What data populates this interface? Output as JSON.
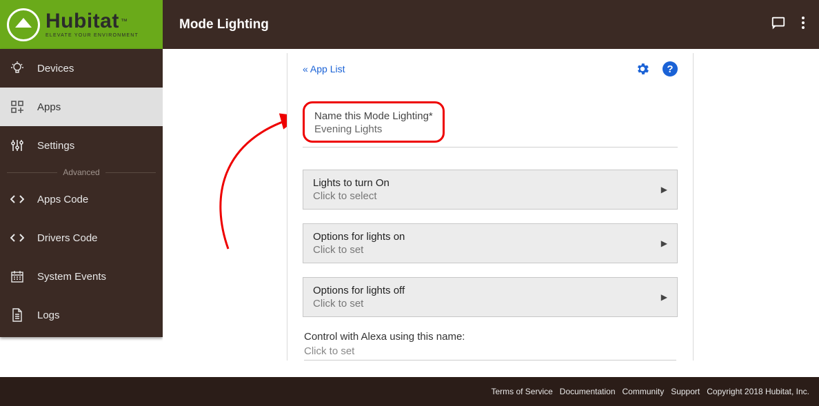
{
  "brand": {
    "name": "Hubitat",
    "tagline": "ELEVATE YOUR ENVIRONMENT",
    "tm": "™"
  },
  "header": {
    "title": "Mode Lighting"
  },
  "sidebar": {
    "items": [
      {
        "label": "Devices"
      },
      {
        "label": "Apps"
      },
      {
        "label": "Settings"
      }
    ],
    "advanced_label": "Advanced",
    "advanced_items": [
      {
        "label": "Apps Code"
      },
      {
        "label": "Drivers Code"
      },
      {
        "label": "System Events"
      },
      {
        "label": "Logs"
      }
    ]
  },
  "panel": {
    "back_link": "« App List",
    "help_glyph": "?",
    "name_label": "Name this Mode Lighting*",
    "name_value": "Evening Lights",
    "rows": [
      {
        "title": "Lights to turn On",
        "sub": "Click to select"
      },
      {
        "title": "Options for lights on",
        "sub": "Click to set"
      },
      {
        "title": "Options for lights off",
        "sub": "Click to set"
      }
    ],
    "alexa_label": "Control with Alexa using this name:",
    "alexa_value": "Click to set"
  },
  "footer": {
    "links": [
      "Terms of Service",
      "Documentation",
      "Community",
      "Support"
    ],
    "copyright": "Copyright 2018 Hubitat, Inc."
  }
}
